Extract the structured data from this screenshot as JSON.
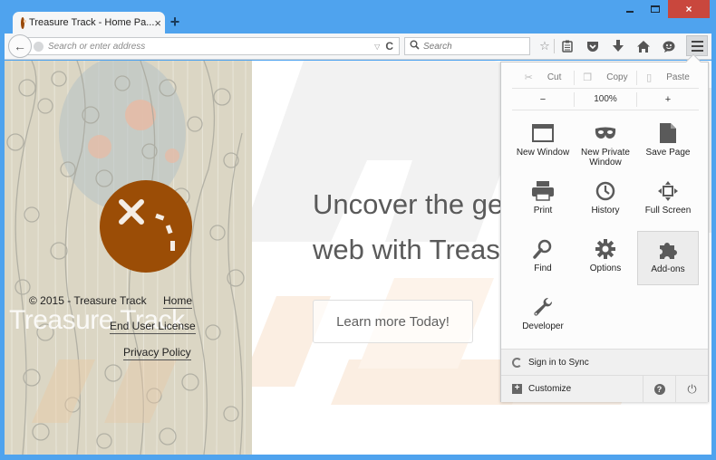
{
  "browser": {
    "tab_title": "Treasure Track - Home Pa...",
    "tab_close": "×",
    "new_tab": "+",
    "window_close": "×",
    "url_placeholder": "Search or enter address",
    "search_placeholder": "Search",
    "dropmarker": "▽",
    "reload": "C",
    "back": "←",
    "toolbar_icons": [
      "bookmark-star-icon",
      "reading-list-icon",
      "pocket-icon",
      "downloads-icon",
      "home-icon",
      "hello-chat-icon",
      "menu-icon"
    ]
  },
  "page": {
    "headline_line1": "Uncover the ge",
    "headline_line2": "web with Treas",
    "cta": "Learn more Today!",
    "copyright": "© 2015 - Treasure Track",
    "brand_overlay": "Treasure Track",
    "links": {
      "home": "Home",
      "eula": "End User License",
      "privacy": "Privacy Policy"
    },
    "brand_color": "#9b4d06"
  },
  "menu": {
    "edit": {
      "cut": "Cut",
      "copy": "Copy",
      "paste": "Paste"
    },
    "zoom": {
      "minus": "−",
      "level": "100%",
      "plus": "+"
    },
    "items": [
      {
        "id": "new-window",
        "label": "New Window"
      },
      {
        "id": "new-private-window",
        "label": "New Private Window"
      },
      {
        "id": "save-page",
        "label": "Save Page"
      },
      {
        "id": "print",
        "label": "Print"
      },
      {
        "id": "history",
        "label": "History"
      },
      {
        "id": "full-screen",
        "label": "Full Screen"
      },
      {
        "id": "find",
        "label": "Find"
      },
      {
        "id": "options",
        "label": "Options"
      },
      {
        "id": "add-ons",
        "label": "Add-ons",
        "active": true
      },
      {
        "id": "developer",
        "label": "Developer"
      }
    ],
    "sync": "Sign in to Sync",
    "customize": "Customize",
    "help": "?",
    "quit": "⏻"
  }
}
